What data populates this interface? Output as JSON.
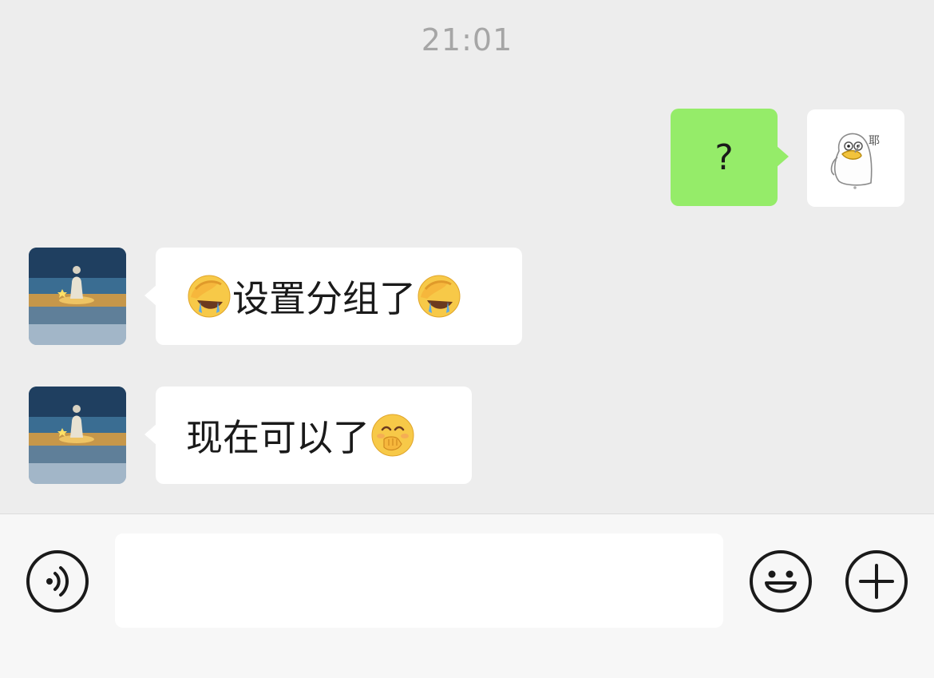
{
  "chat": {
    "timestamp": "21:01",
    "messages": [
      {
        "direction": "outgoing",
        "text": "?"
      },
      {
        "direction": "incoming",
        "text": "设置分组了",
        "emoji_before": "face-palm-crying-emoji",
        "emoji_after": "face-palm-crying-emoji"
      },
      {
        "direction": "incoming",
        "text": "现在可以了",
        "emoji_after": "hand-over-mouth-emoji"
      }
    ]
  },
  "sticker": {
    "text": "耶"
  },
  "input_bar": {
    "voice_icon": "voice-icon",
    "message_value": "",
    "emoji_icon": "smiley-icon",
    "more_icon": "plus-icon"
  },
  "colors": {
    "background": "#ededed",
    "outgoing_bubble": "#95ec69",
    "incoming_bubble": "#ffffff",
    "timestamp": "#a6a6a6",
    "input_bar": "#f7f7f7"
  }
}
